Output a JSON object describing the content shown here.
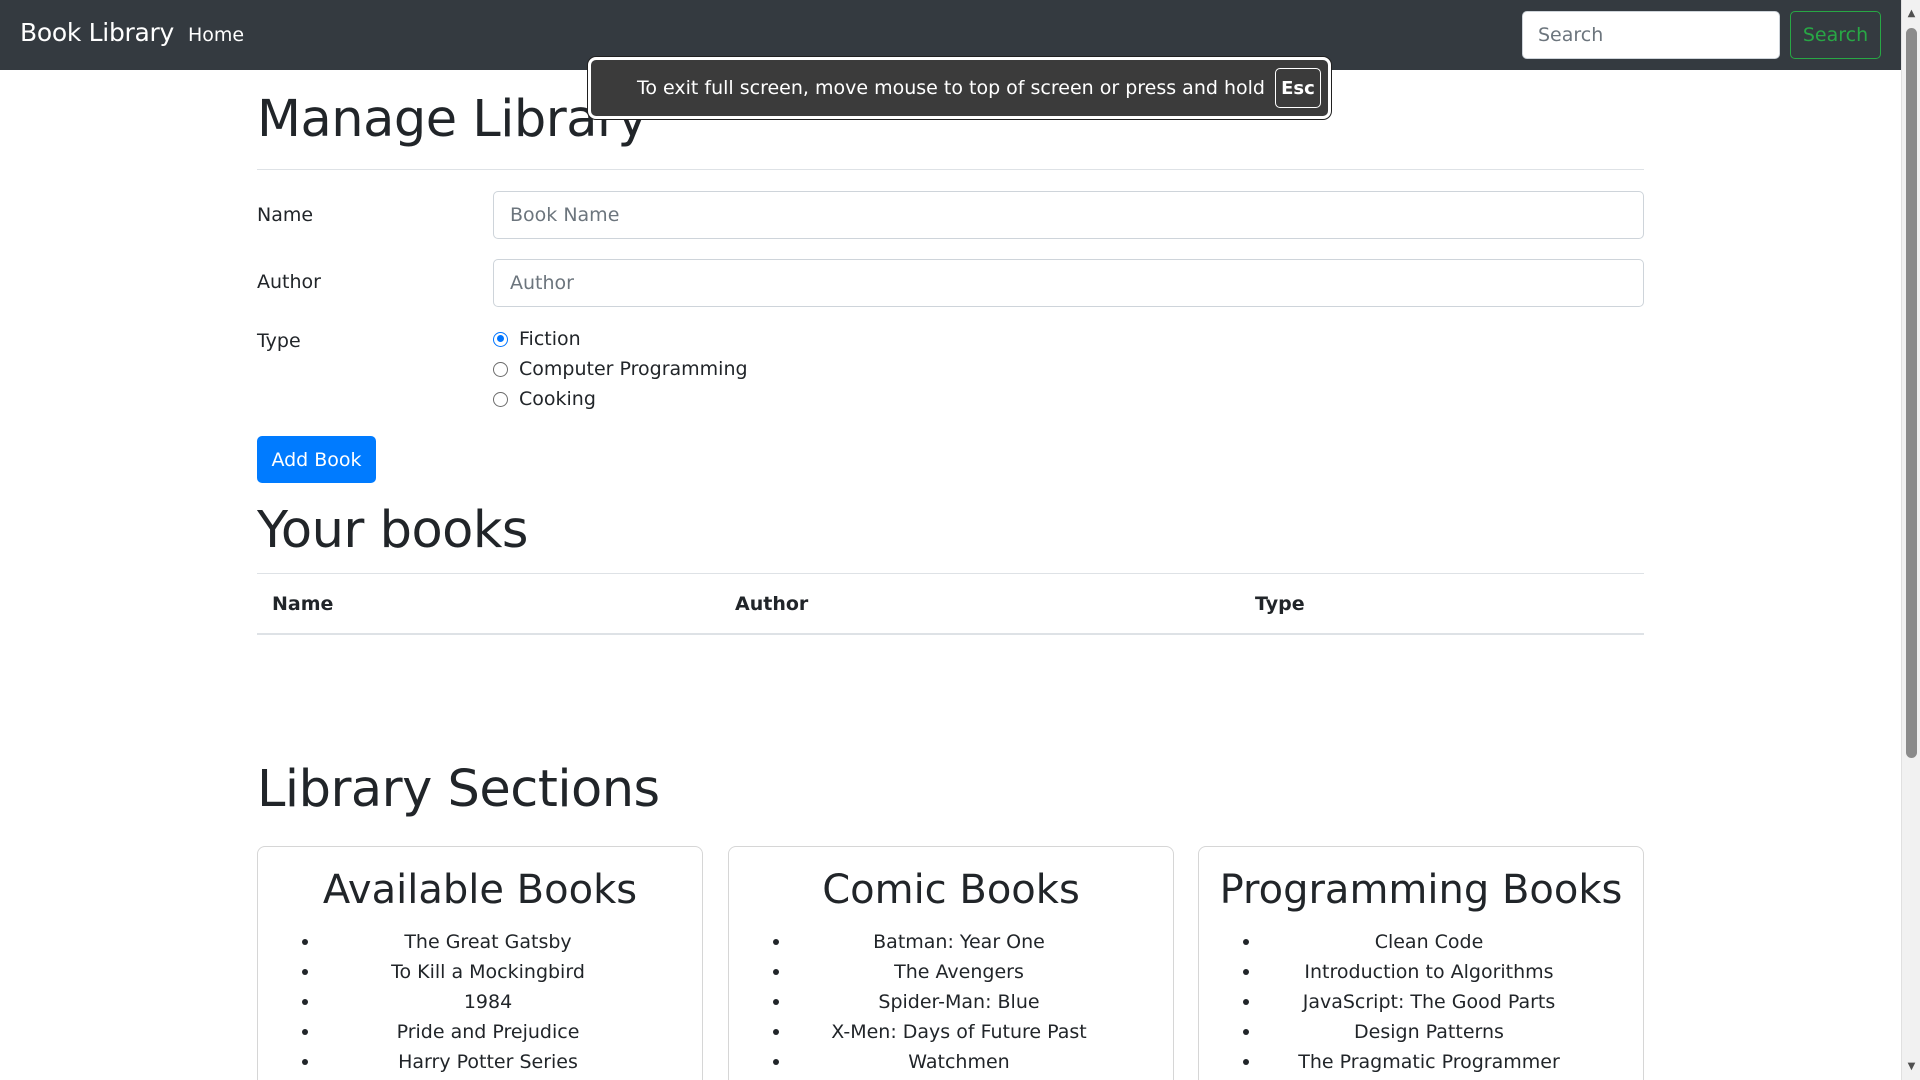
{
  "navbar": {
    "brand": "Book Library",
    "home": "Home",
    "search_placeholder": "Search",
    "search_button": "Search"
  },
  "fullscreen_toast": {
    "message": "To exit full screen, move mouse to top of screen or press and hold",
    "key": "Esc"
  },
  "manage": {
    "title": "Manage Library",
    "name_label": "Name",
    "name_placeholder": "Book Name",
    "author_label": "Author",
    "author_placeholder": "Author",
    "type_label": "Type",
    "types": [
      {
        "label": "Fiction",
        "checked": true
      },
      {
        "label": "Computer Programming",
        "checked": false
      },
      {
        "label": "Cooking",
        "checked": false
      }
    ],
    "add_button": "Add Book"
  },
  "your_books": {
    "title": "Your books",
    "columns": [
      "Name",
      "Author",
      "Type"
    ]
  },
  "sections": {
    "title": "Library Sections",
    "cards": [
      {
        "title": "Available Books",
        "items": [
          "The Great Gatsby",
          "To Kill a Mockingbird",
          "1984",
          "Pride and Prejudice",
          "Harry Potter Series"
        ]
      },
      {
        "title": "Comic Books",
        "items": [
          "Batman: Year One",
          "The Avengers",
          "Spider-Man: Blue",
          "X-Men: Days of Future Past",
          "Watchmen"
        ]
      },
      {
        "title": "Programming Books",
        "items": [
          "Clean Code",
          "Introduction to Algorithms",
          "JavaScript: The Good Parts",
          "Design Patterns",
          "The Pragmatic Programmer"
        ]
      }
    ]
  },
  "colors": {
    "navbar_bg": "#343a40",
    "primary": "#007bff",
    "success": "#28a745"
  }
}
